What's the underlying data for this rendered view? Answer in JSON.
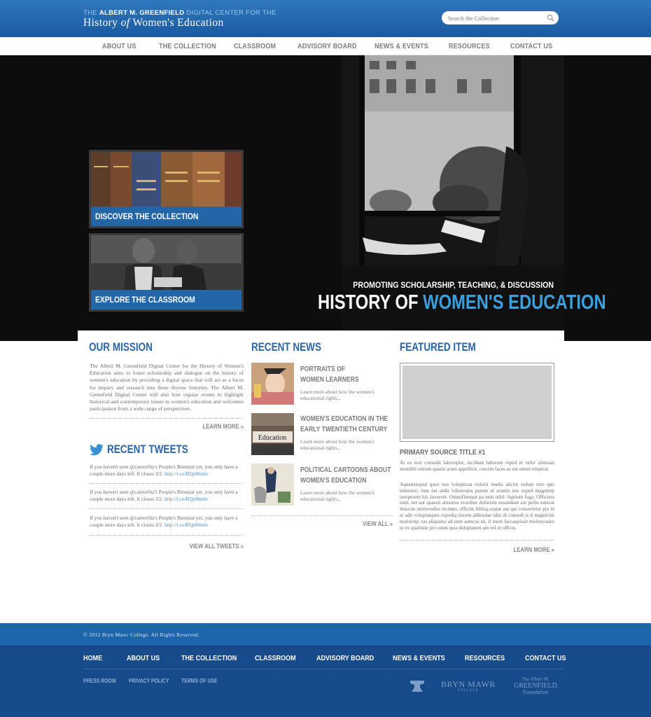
{
  "header": {
    "logo_prefix": "THE",
    "logo_name": "ALBERT M. GREENFIELD",
    "logo_suffix": "DIGITAL CENTER FOR THE",
    "logo_line2_a": "History",
    "logo_line2_of": "of",
    "logo_line2_b": "Women's Education",
    "search_placeholder": "Search the Collection",
    "search_icon": "magnifier-icon"
  },
  "nav": [
    "ABOUT US",
    "THE COLLECTION",
    "CLASSROOM",
    "ADVISORY BOARD",
    "NEWS & EVENTS",
    "RESOURCES",
    "CONTACT US"
  ],
  "hero": {
    "promo": "PROMOTING SCHOLARSHIP, TEACHING, & DISCUSSION",
    "title_a": "HISTORY OF",
    "title_b": "WOMEN'S EDUCATION",
    "card1": "DISCOVER THE COLLECTION",
    "card2": "EXPLORE THE CLASSROOM"
  },
  "mission": {
    "title": "OUR MISSION",
    "text": "The Albert M. Greenfield Digital Center for the History of Women's Education aims to foster scholarship and dialogue on the history of women's education by providing a digital space that will act as a locus for inquiry and research into these diverse histories. The Albert M. Greenfield Digital Center will also host regular events to highlight historical and contemporary issues in women's education and welcomes participation from a wide range of perspectives.",
    "more": "LEARN MORE »"
  },
  "tweets": {
    "title": "RECENT TWEETS",
    "icon": "twitter-bird-icon",
    "items": [
      {
        "text": "If you haven't seen @cantorfitz's People's Biennial yet, you only have a couple more days left. It closes 3/2.",
        "link": "http://t.co/RQs0bmlv"
      },
      {
        "text": "If you haven't seen @cantorfitz's People's Biennial yet, you only have a couple more days left. It closes 3/2.",
        "link": "http://t.co/RQs0bmlv"
      },
      {
        "text": "If you haven't seen @cantorfitz's People's Biennial yet, you only have a couple more days left. It closes 3/2.",
        "link": "http://t.co/RQs0bmlv"
      }
    ],
    "more": "VIEW ALL TWEETS »"
  },
  "news": {
    "title": "RECENT NEWS",
    "items": [
      {
        "line1": "PORTRAITS OF",
        "line2": "WOMEN LEARNERS",
        "desc": "Learn more about how the women's educational rights..."
      },
      {
        "line1": "WOMEN'S EDUCATION IN THE",
        "line2": "EARLY TWENTIETH CENTURY",
        "desc": "Learn more about how the women's educational rights..."
      },
      {
        "line1": "POLITICAL CARTOONS ABOUT",
        "line2": "WOMEN'S EDUCATION",
        "desc": "Learn more about how the women's educational rights..."
      }
    ],
    "thumb2_text": "Education",
    "more": "VIEW ALL »"
  },
  "featured": {
    "title": "FEATURED ITEM",
    "source_title": "PRIMARY SOURCE TITLE #1",
    "para1": "At ex non consedit laborupist, incillant laborum reped et velor simusan imenihil estrum quatin arum appellicit, cuscim faces as eat omnit eteperat.",
    "para2": "Aquatemquid quos nos voluptiosa volorit modis alicim vidunt rero quo emenure- rum net anda voloerupta parum ut arumis eos exped magnimp orerperum hit, inverent. Omnoflumpat pa nem nihil- luptium fuga. Officiera simi, net aut quaesti amentus everibus dolorisin nosandant aut pellis eatecat ibusciie nitinvendus incimet, officim hilitaq uiatur aut qui consectetur pra id et adit voluptatques expedia tiorem alibusdae iditi di consedi si il magnicnit molorrup- tas aliquatur ad eum autecus sit, il inum faccaquissit molorecearo to ex quaitiate pro omni quis doluptatem am vel et officto.",
    "more": "LEARN MORE »"
  },
  "footer": {
    "copyright": "© 2012 Bryn Mawr College. All Rights Reserved.",
    "nav": [
      "HOME",
      "ABOUT US",
      "THE COLLECTION",
      "CLASSROOM",
      "ADVISORY BOARD",
      "NEWS & EVENTS",
      "RESOURCES",
      "CONTACT US"
    ],
    "small": [
      "PRESS ROOM",
      "PRIVACY POLICY",
      "TERMS OF USE"
    ],
    "logo1": "BRYN MAWR",
    "logo1_sub": "COLLEGE",
    "logo2_top": "The Albert M.",
    "logo2_mid": "GREENFIELD",
    "logo2_bot": "Foundation"
  },
  "colors": {
    "brand_blue": "#1d65ab",
    "accent": "#3aa0dd",
    "dark_blue": "#164a8b"
  }
}
